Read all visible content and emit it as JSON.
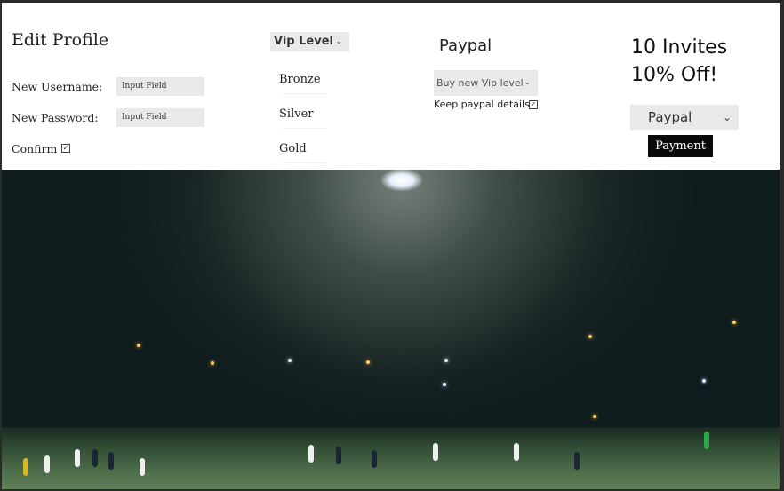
{
  "profile": {
    "title": "Edit Profile",
    "username_label": "New Username:",
    "username_value": "Input Field",
    "password_label": "New Password:",
    "password_value": "Input Field",
    "confirm_label": "Confirm",
    "confirm_checked": true
  },
  "vip": {
    "select_label": "Vip Level",
    "options": [
      "Bronze",
      "Silver",
      "Gold"
    ]
  },
  "paypal": {
    "title": "Paypal",
    "buy_select_label": "Buy new Vip level",
    "keep_details_label": "Keep paypal details",
    "keep_details_checked": true
  },
  "promo": {
    "line1": "10 Invites",
    "line2": "10% Off!",
    "payment_method": "Paypal",
    "payment_button": "Payment"
  },
  "icons": {
    "chevron": "chevron-down-icon",
    "check": "check-icon"
  },
  "colors": {
    "panel_bg": "#ffffff",
    "input_bg": "#e9e9e9",
    "button_bg": "#0a0a0a"
  }
}
